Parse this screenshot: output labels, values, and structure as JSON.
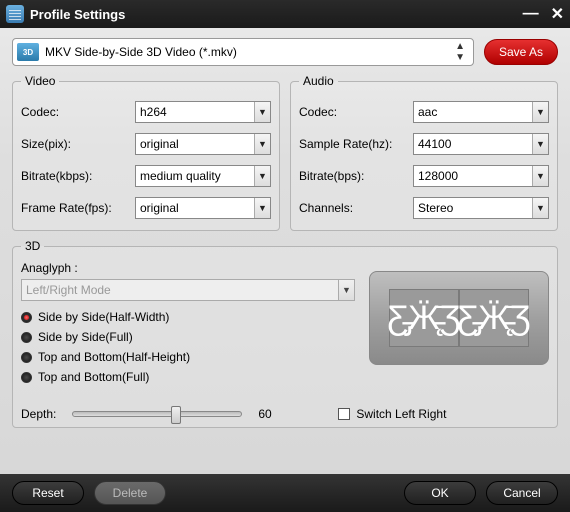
{
  "window": {
    "title": "Profile Settings"
  },
  "top": {
    "profile": "MKV Side-by-Side 3D Video (*.mkv)",
    "fmt_badge": "3D",
    "save_as": "Save As"
  },
  "video": {
    "legend": "Video",
    "codec_label": "Codec:",
    "codec": "h264",
    "size_label": "Size(pix):",
    "size": "original",
    "bitrate_label": "Bitrate(kbps):",
    "bitrate": "medium quality",
    "fps_label": "Frame Rate(fps):",
    "fps": "original"
  },
  "audio": {
    "legend": "Audio",
    "codec_label": "Codec:",
    "codec": "aac",
    "sr_label": "Sample Rate(hz):",
    "sr": "44100",
    "bitrate_label": "Bitrate(bps):",
    "bitrate": "128000",
    "ch_label": "Channels:",
    "ch": "Stereo"
  },
  "three_d": {
    "legend": "3D",
    "anaglyph_label": "Anaglyph :",
    "anaglyph_placeholder": "Left/Right Mode",
    "options": [
      "Side by Side(Half-Width)",
      "Side by Side(Full)",
      "Top and Bottom(Half-Height)",
      "Top and Bottom(Full)"
    ],
    "selected_index": 0,
    "depth_label": "Depth:",
    "depth_value": "60",
    "switch_label": "Switch Left Right",
    "switch_checked": false
  },
  "footer": {
    "reset": "Reset",
    "delete": "Delete",
    "ok": "OK",
    "cancel": "Cancel"
  }
}
